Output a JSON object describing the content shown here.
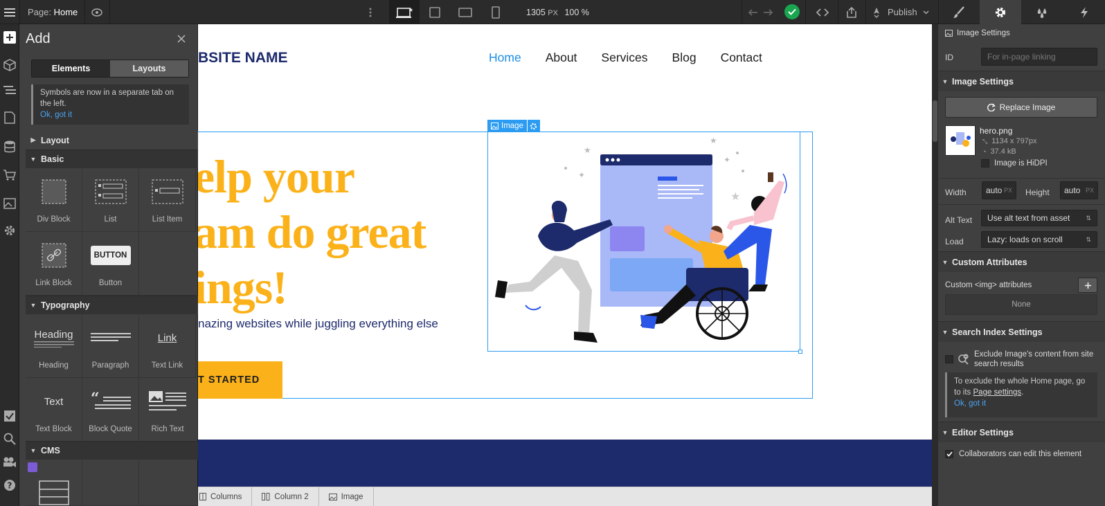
{
  "topbar": {
    "page_label": "Page:",
    "page_name": "Home",
    "width_value": "1305",
    "width_unit": "PX",
    "zoom": "100 %",
    "publish_label": "Publish"
  },
  "add_panel": {
    "title": "Add",
    "tabs": [
      "Elements",
      "Layouts"
    ],
    "notice_text": "Symbols are now in a separate tab on the left.",
    "notice_link": "Ok, got it",
    "sections": {
      "layout": "Layout",
      "basic": "Basic",
      "typography": "Typography",
      "cms": "CMS"
    },
    "basic_items": [
      "Div Block",
      "List",
      "List Item",
      "Link Block",
      "Button"
    ],
    "button_preview": "BUTTON",
    "typography_items": [
      "Heading",
      "Paragraph",
      "Text Link",
      "Text Block",
      "Block Quote",
      "Rich Text"
    ],
    "heading_preview": "Heading",
    "link_preview": "Link",
    "text_preview": "Text"
  },
  "canvas": {
    "site_name": "BSITE NAME",
    "nav": [
      "Home",
      "About",
      "Services",
      "Blog",
      "Contact"
    ],
    "hero_lines": [
      "elp your",
      "am do great",
      "ings!"
    ],
    "subtext": "nazing websites while juggling everything else",
    "cta": "T STARTED",
    "selection_label": "Image",
    "colors": {
      "accent": "#fbb21a",
      "navy": "#1d2a6b",
      "nav_active": "#1c8de4",
      "selection": "#2b9cf2"
    }
  },
  "breadcrumb": [
    "Columns",
    "Column 2",
    "Image"
  ],
  "right_panel": {
    "header": "Image Settings",
    "id_label": "ID",
    "id_placeholder": "For in-page linking",
    "image_settings": "Image Settings",
    "replace_button": "Replace Image",
    "file_name": "hero.png",
    "file_dims": "1134 x 797px",
    "file_size": "37.4 kB",
    "hidpi_label": "Image is HiDPI",
    "width_label": "Width",
    "width_value": "auto",
    "height_label": "Height",
    "height_value": "auto",
    "unit": "PX",
    "alt_label": "Alt Text",
    "alt_value": "Use alt text from asset",
    "load_label": "Load",
    "load_value": "Lazy: loads on scroll",
    "custom_attrs": "Custom Attributes",
    "custom_img_label": "Custom <img> attributes",
    "none": "None",
    "search_index": "Search Index Settings",
    "exclude_label": "Exclude Image's content from site search results",
    "exclude_note_1": "To exclude the whole Home page, go to its",
    "exclude_note_link": "Page settings",
    "exclude_note_2": ".",
    "exclude_ok": "Ok, got it",
    "editor_settings": "Editor Settings",
    "collaborators_label": "Collaborators can edit this element"
  }
}
